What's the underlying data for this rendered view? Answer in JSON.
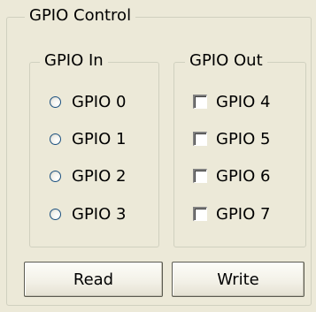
{
  "gpio_control": {
    "title": "GPIO Control",
    "gpio_in": {
      "title": "GPIO In",
      "items": [
        {
          "label": "GPIO 0",
          "selected": false
        },
        {
          "label": "GPIO 1",
          "selected": false
        },
        {
          "label": "GPIO 2",
          "selected": false
        },
        {
          "label": "GPIO 3",
          "selected": false
        }
      ]
    },
    "gpio_out": {
      "title": "GPIO Out",
      "items": [
        {
          "label": "GPIO 4",
          "checked": false
        },
        {
          "label": "GPIO 5",
          "checked": false
        },
        {
          "label": "GPIO 6",
          "checked": false
        },
        {
          "label": "GPIO 7",
          "checked": false
        }
      ]
    },
    "buttons": {
      "read_label": "Read",
      "write_label": "Write"
    }
  }
}
